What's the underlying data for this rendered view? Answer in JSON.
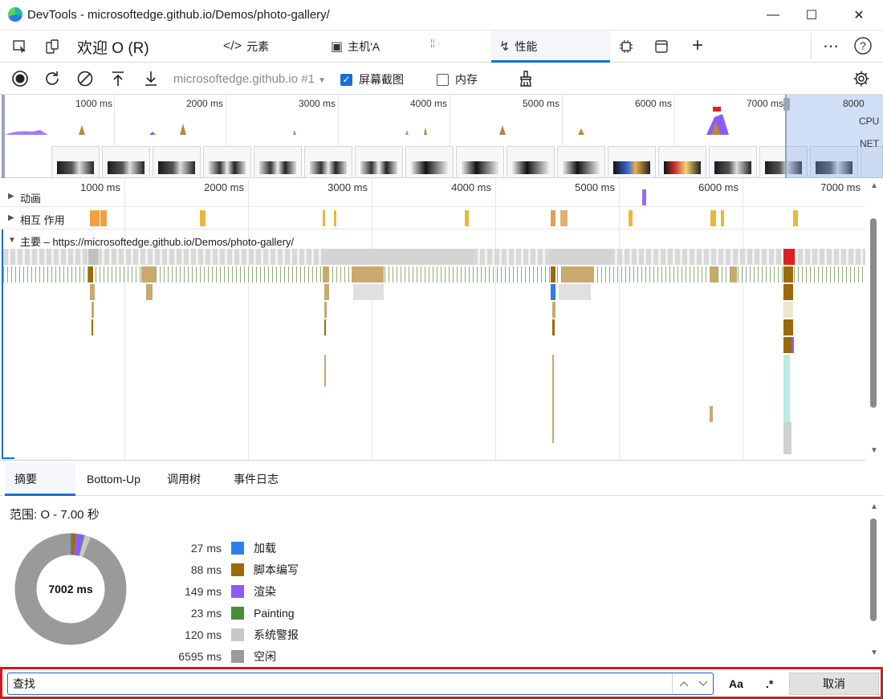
{
  "window": {
    "title": "DevTools - microsoftedge.github.io/Demos/photo-gallery/",
    "minimize_glyph": "—",
    "maximize_glyph": "☐",
    "close_glyph": "✕"
  },
  "tabs": [
    {
      "label": "欢迎 O (R)",
      "icon": "welcome"
    },
    {
      "label": "元素",
      "icon": "code-icon",
      "glyph": "</>"
    },
    {
      "label": "主机'A",
      "icon": "console-icon",
      "glyph": "▣"
    },
    {
      "label": "性能",
      "icon": "performance-icon",
      "glyph": "↯",
      "active": true
    }
  ],
  "toolbar": {
    "target": "microsoftedge.github.io #1",
    "screenshots_label": "屏幕截图",
    "screenshots_checked": true,
    "memory_label": "内存",
    "memory_checked": false
  },
  "overview": {
    "ticks": [
      "1000 ms",
      "2000 ms",
      "3000 ms",
      "4000 ms",
      "5000 ms",
      "6000 ms",
      "7000 ms",
      "8000"
    ],
    "cpu_label": "CPU",
    "net_label": "NET"
  },
  "timeline": {
    "ticks": [
      "1000 ms",
      "2000 ms",
      "3000 ms",
      "4000 ms",
      "5000 ms",
      "6000 ms",
      "7000 ms"
    ],
    "tracks": {
      "animations": "动画",
      "interactions": "相互 作用",
      "main": "主要 – https://microsoftedge.github.io/Demos/photo-gallery/"
    }
  },
  "bottom_tabs": [
    {
      "label": "摘要",
      "active": true
    },
    {
      "label": "Bottom-Up"
    },
    {
      "label": "调用树"
    },
    {
      "label": "事件日志"
    }
  ],
  "summary": {
    "range": "范围: O - 7.00 秒",
    "total": "7002 ms",
    "items": [
      {
        "ms": "27 ms",
        "label": "加载",
        "color": "#2d7ee8"
      },
      {
        "ms": "88 ms",
        "label": "脚本编写",
        "color": "#9b6a0c"
      },
      {
        "ms": "149 ms",
        "label": "渲染",
        "color": "#8b5cf6"
      },
      {
        "ms": "23 ms",
        "label": "Painting",
        "color": "#4a8c3c"
      },
      {
        "ms": "120 ms",
        "label": "系统警报",
        "color": "#c8c8c8"
      },
      {
        "ms": "6595 ms",
        "label": "空闲",
        "color": "#9a9a9a"
      }
    ]
  },
  "find": {
    "value": "查找",
    "case_label": "Aa",
    "regex_label": ".*",
    "cancel_label": "取消"
  }
}
